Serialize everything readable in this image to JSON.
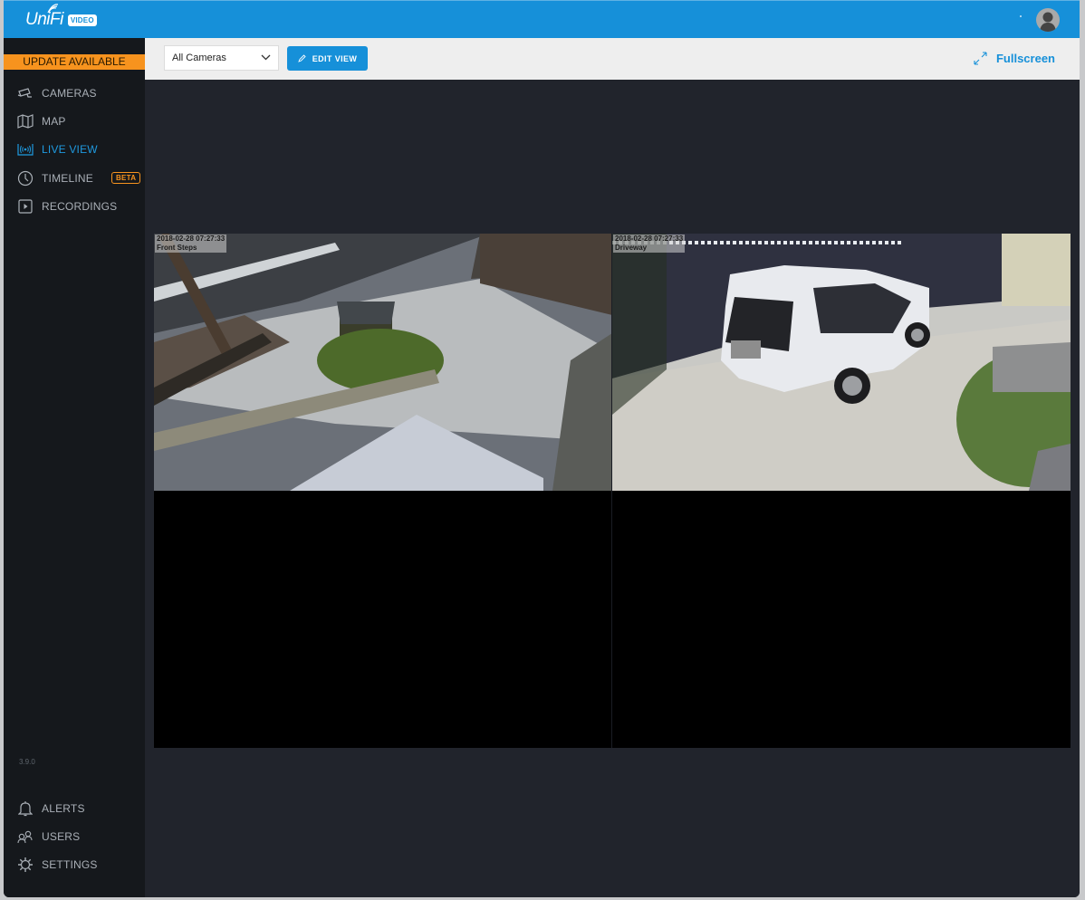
{
  "app": {
    "logo_text": "UniFi",
    "logo_badge": "VIDEO"
  },
  "sidebar": {
    "update_banner": "UPDATE AVAILABLE",
    "items": [
      {
        "label": "CAMERAS",
        "icon": "camera-icon",
        "active": false
      },
      {
        "label": "MAP",
        "icon": "map-icon",
        "active": false
      },
      {
        "label": "LIVE VIEW",
        "icon": "live-view-icon",
        "active": true
      },
      {
        "label": "TIMELINE",
        "icon": "clock-icon",
        "active": false,
        "badge": "BETA"
      },
      {
        "label": "RECORDINGS",
        "icon": "play-icon",
        "active": false
      }
    ],
    "version": "3.9.0",
    "bottom_items": [
      {
        "label": "ALERTS",
        "icon": "bell-icon"
      },
      {
        "label": "USERS",
        "icon": "users-icon"
      },
      {
        "label": "SETTINGS",
        "icon": "gear-icon"
      }
    ]
  },
  "toolbar": {
    "camera_select": "All Cameras",
    "edit_view_label": "EDIT VIEW",
    "fullscreen_label": "Fullscreen"
  },
  "cameras": [
    {
      "name": "Front Steps",
      "timestamp": "2018-02-28 07:27:33"
    },
    {
      "name": "Driveway",
      "timestamp": "2018-02-28 07:27:33"
    }
  ],
  "colors": {
    "accent": "#1690d9",
    "update": "#f7931e",
    "sidebar_bg": "#15181c",
    "main_bg": "#21242c"
  }
}
